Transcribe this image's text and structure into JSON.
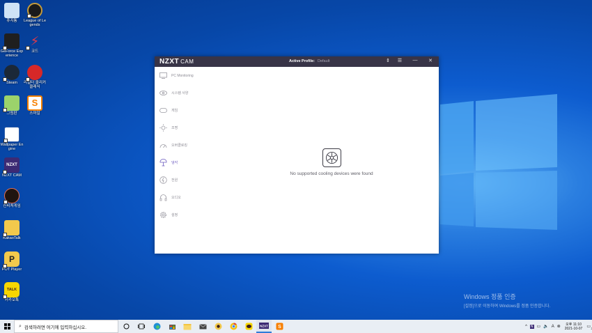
{
  "desktop": {
    "icons": [
      {
        "label": "휴지통",
        "color": "#cfe3f6"
      },
      {
        "label": "League of Legends",
        "color": "#c59b3c"
      },
      {
        "label": "GeForce Experience",
        "color": "#1f1f1f"
      },
      {
        "label": "코드",
        "color": "#e63946"
      },
      {
        "label": "Steam",
        "color": "#1b2838"
      },
      {
        "label": "리얼터 클리커 클래식",
        "color": "#d62828"
      },
      {
        "label": "그림판",
        "color": "#f4a261"
      },
      {
        "label": "스마일",
        "color": "#f77f00"
      },
      {
        "label": "Wallpaper Engine",
        "color": "#2b5ba8"
      },
      {
        "label": "NZXT CAM",
        "color": "#3c2a74"
      },
      {
        "label": "신피처게임",
        "color": "#e76f51"
      },
      {
        "label": "KakaoTalk",
        "color": "#f2c94c"
      },
      {
        "label": "POT Player",
        "color": "#f2c94c"
      },
      {
        "label": "카카오톡",
        "color": "#f7d600"
      }
    ]
  },
  "window": {
    "logo": "NZXT",
    "logo_suffix": "CAM",
    "active_profile_label": "Active Profile:",
    "active_profile_value": "Default",
    "nav": [
      {
        "label": "PC Monitoring",
        "icon": "monitor-icon"
      },
      {
        "label": "시스템 사양",
        "icon": "eye-icon"
      },
      {
        "label": "게임",
        "icon": "gamepad-icon"
      },
      {
        "label": "조명",
        "icon": "sun-icon"
      },
      {
        "label": "오버클로킹",
        "icon": "speedometer-icon"
      },
      {
        "label": "냉각",
        "icon": "thermometer-icon"
      },
      {
        "label": "전원",
        "icon": "power-icon"
      },
      {
        "label": "오디오",
        "icon": "headphones-icon"
      },
      {
        "label": "설정",
        "icon": "gear-icon"
      }
    ],
    "message": "No supported cooling devices were found"
  },
  "activation": {
    "title": "Windows 정품 인증",
    "subtitle": "[설정]으로 이동하여 Windows를 정품 인증합니다."
  },
  "taskbar": {
    "search_placeholder": "검색하려면 여기에 입력하십시오.",
    "clock_time": "오후 11:10",
    "clock_date": "2021-10-07",
    "notification_count": "3"
  }
}
